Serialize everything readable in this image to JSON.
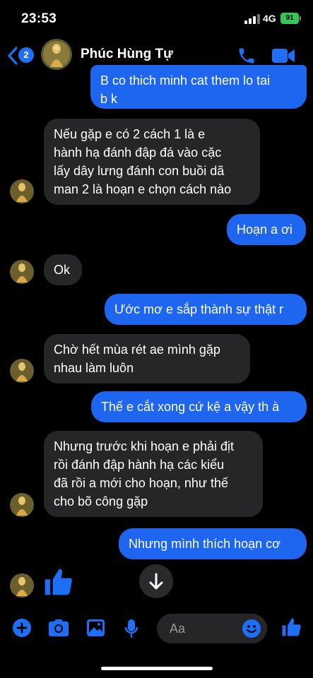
{
  "status_bar": {
    "time": "23:53",
    "network": "4G",
    "battery": "91"
  },
  "header": {
    "unread_count": "2",
    "contact_name": "Phúc Hùng Tự"
  },
  "messages": [
    {
      "from": "me",
      "text": "B co thich minh cat them lo tai\nb k"
    },
    {
      "from": "them",
      "text": "Nếu gặp e có 2 cách 1 là e\nhành hạ đánh đập đá vào cặc\nlấy dây lưng đánh con buồi dã\nman 2 là hoạn e chọn cách nào"
    },
    {
      "from": "me",
      "text": "Hoạn a ơi"
    },
    {
      "from": "them",
      "text": "Ok"
    },
    {
      "from": "me",
      "text": "Ước mơ e sắp thành sự thật r"
    },
    {
      "from": "them",
      "text": "Chờ hết mùa rét ae mình gặp\nnhau làm luôn"
    },
    {
      "from": "me",
      "text": "Thế e cắt xong cứ kệ a vậy th à"
    },
    {
      "from": "them",
      "text": "Nhưng trước khi hoạn e phải địt\nrồi đánh đập hành hạ các kiểu\nđã rồi a mới cho hoạn, như thế\ncho bõ công gặp"
    },
    {
      "from": "me",
      "text": "Nhưng mình thích hoạn cơ"
    }
  ],
  "composer": {
    "placeholder": "Aa"
  },
  "icons": [
    "back-chevron-icon",
    "phone-icon",
    "video-camera-icon",
    "like-thumb-icon",
    "scroll-down-arrow-icon",
    "plus-icon",
    "camera-icon",
    "image-icon",
    "microphone-icon",
    "emoji-icon"
  ],
  "colors": {
    "accent": "#1e65ef",
    "incoming_bubble": "#262629",
    "background": "#000000"
  }
}
